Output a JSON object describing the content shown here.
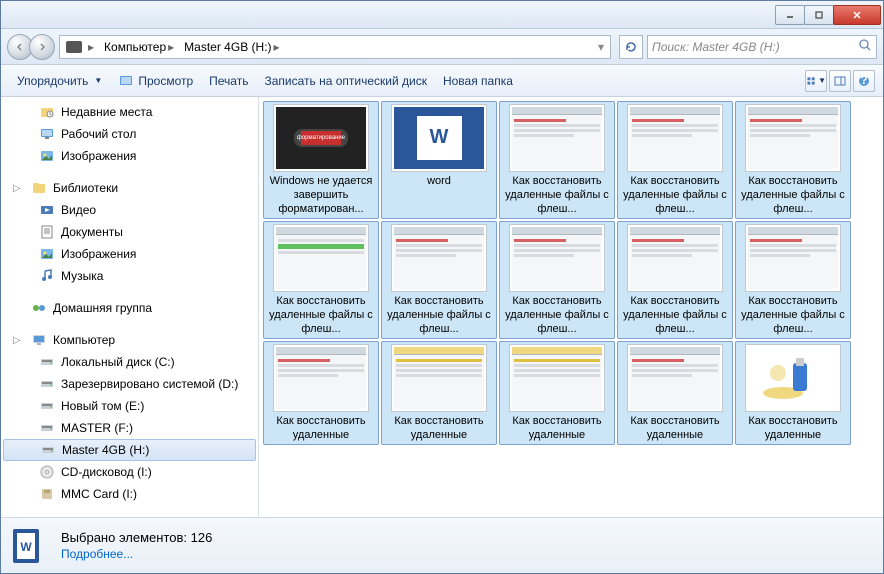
{
  "titlebar": {
    "min": "_",
    "max": "□",
    "close": "×"
  },
  "nav": {
    "breadcrumb": [
      "Компьютер",
      "Master 4GB (H:)"
    ],
    "search_placeholder": "Поиск: Master 4GB (H:)"
  },
  "toolbar": {
    "organize": "Упорядочить",
    "preview": "Просмотр",
    "print": "Печать",
    "burn": "Записать на оптический диск",
    "newfolder": "Новая папка"
  },
  "sidebar": {
    "fav": [
      {
        "icon": "recent",
        "label": "Недавние места"
      },
      {
        "icon": "desktop",
        "label": "Рабочий стол"
      },
      {
        "icon": "pictures",
        "label": "Изображения"
      }
    ],
    "lib_header": "Библиотеки",
    "lib": [
      {
        "icon": "video",
        "label": "Видео"
      },
      {
        "icon": "docs",
        "label": "Документы"
      },
      {
        "icon": "pictures",
        "label": "Изображения"
      },
      {
        "icon": "music",
        "label": "Музыка"
      }
    ],
    "homegroup": "Домашняя группа",
    "computer": "Компьютер",
    "drives": [
      {
        "icon": "hdd",
        "label": "Локальный диск (C:)"
      },
      {
        "icon": "hdd",
        "label": "Зарезервировано системой (D:)"
      },
      {
        "icon": "hdd",
        "label": "Новый том (E:)"
      },
      {
        "icon": "hdd",
        "label": "MASTER (F:)"
      },
      {
        "icon": "hdd",
        "label": "Master 4GB (H:)",
        "selected": true
      },
      {
        "icon": "cd",
        "label": "CD-дисковод (I:)"
      },
      {
        "icon": "mmc",
        "label": "MMC Card (I:)"
      }
    ]
  },
  "files": [
    {
      "label": "Windows не удается завершить форматирован...",
      "t": "usb"
    },
    {
      "label": "word",
      "t": "word"
    },
    {
      "label": "Как восстановить удаленные файлы с флеш...",
      "t": "win"
    },
    {
      "label": "Как восстановить удаленные файлы с флеш...",
      "t": "win"
    },
    {
      "label": "Как восстановить удаленные файлы с флеш...",
      "t": "win"
    },
    {
      "label": "Как восстановить удаленные файлы с флеш...",
      "t": "green"
    },
    {
      "label": "Как восстановить удаленные файлы с флеш...",
      "t": "win"
    },
    {
      "label": "Как восстановить удаленные файлы с флеш...",
      "t": "win"
    },
    {
      "label": "Как восстановить удаленные файлы с флеш...",
      "t": "win"
    },
    {
      "label": "Как восстановить удаленные файлы с флеш...",
      "t": "win"
    },
    {
      "label": "Как восстановить удаленные",
      "t": "win"
    },
    {
      "label": "Как восстановить удаленные",
      "t": "yellow"
    },
    {
      "label": "Как восстановить удаленные",
      "t": "yellow"
    },
    {
      "label": "Как восстановить удаленные",
      "t": "win"
    },
    {
      "label": "Как восстановить удаленные",
      "t": "usb2"
    }
  ],
  "details": {
    "title": "Выбрано элементов: 126",
    "more": "Подробнее..."
  }
}
